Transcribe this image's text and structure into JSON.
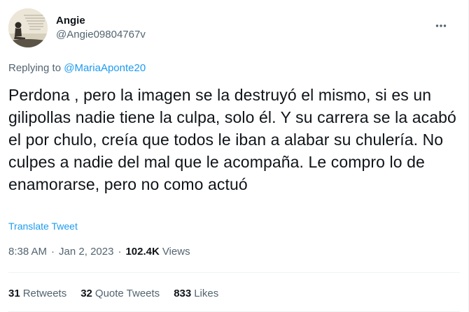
{
  "author": {
    "display_name": "Angie",
    "handle": "@Angie09804767v"
  },
  "reply": {
    "prefix": "Replying to",
    "mention": "@MariaAponte20"
  },
  "tweet": {
    "text": "Perdona , pero la imagen se la destruyó el mismo, si es un gilipollas nadie tiene la culpa, solo él. Y su carrera se la acabó el por chulo, creía que todos le iban a alabar su chulería. No culpes a nadie del mal que le acompaña. Le compro lo de enamorarse, pero no como actuó",
    "translate_label": "Translate Tweet",
    "time": "8:38 AM",
    "separator": "·",
    "date": "Jan 2, 2023",
    "views_count": "102.4K",
    "views_label": "Views"
  },
  "stats": {
    "retweets_count": "31",
    "retweets_label": "Retweets",
    "quotes_count": "32",
    "quotes_label": "Quote Tweets",
    "likes_count": "833",
    "likes_label": "Likes"
  },
  "icons": {
    "more": "more-icon",
    "avatar": "avatar"
  },
  "colors": {
    "link": "#1d9bf0",
    "secondary_text": "#536471",
    "primary_text": "#0f1419",
    "divider": "#eff3f4"
  }
}
